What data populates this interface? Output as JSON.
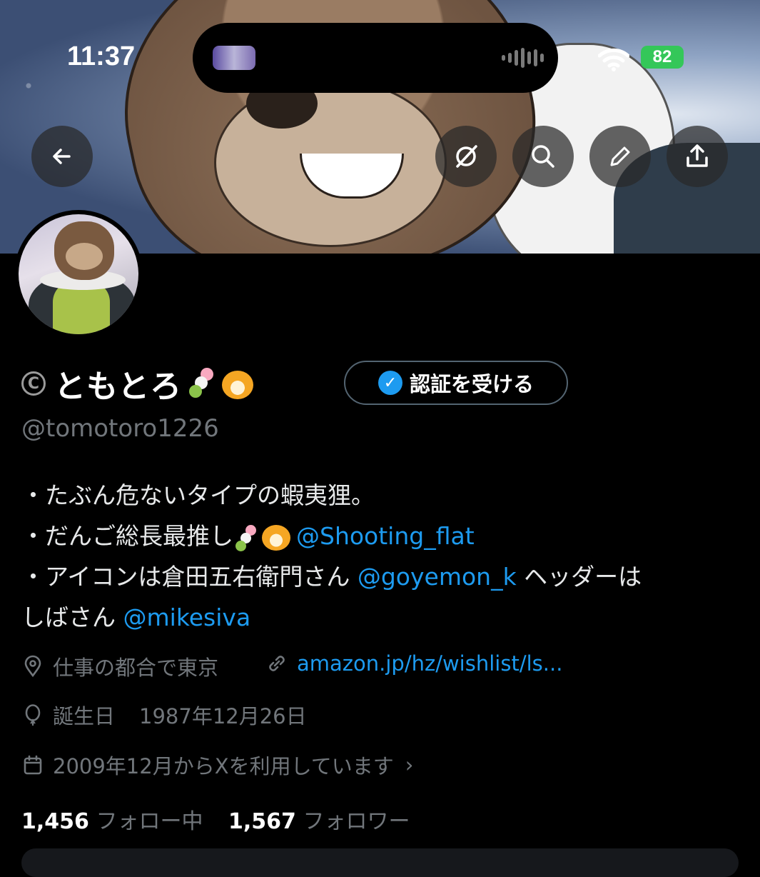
{
  "status_bar": {
    "time": "11:37",
    "battery": "82"
  },
  "header": {
    "back_label": "back",
    "actions": [
      "grok-icon",
      "search-icon",
      "edit-icon",
      "share-icon"
    ]
  },
  "profile": {
    "display_name": "ともとろ",
    "verify_button": "認証を受ける",
    "handle": "@tomotoro1226"
  },
  "bio": {
    "line1": "・たぶん危ないタイプの蝦夷狸。",
    "line2_prefix": "・だんご総長最推し",
    "line2_mention": "@Shooting_flat",
    "line3_prefix": "・アイコンは倉田五右衛門さん ",
    "line3_mention": "@goyemon_k",
    "line3_suffix": " ヘッダーは",
    "line4_prefix": "しばさん ",
    "line4_mention": "@mikesiva"
  },
  "meta": {
    "location": "仕事の都合で東京",
    "link": "amazon.jp/hz/wishlist/ls...",
    "birthday_label": "誕生日",
    "birthday_value": "1987年12月26日",
    "joined": "2009年12月からXを利用しています"
  },
  "stats": {
    "following_count": "1,456",
    "following_label": "フォロー中",
    "followers_count": "1,567",
    "followers_label": "フォロワー"
  },
  "colors": {
    "accent": "#1d9bf0",
    "background": "#000000",
    "muted": "#71767b"
  }
}
